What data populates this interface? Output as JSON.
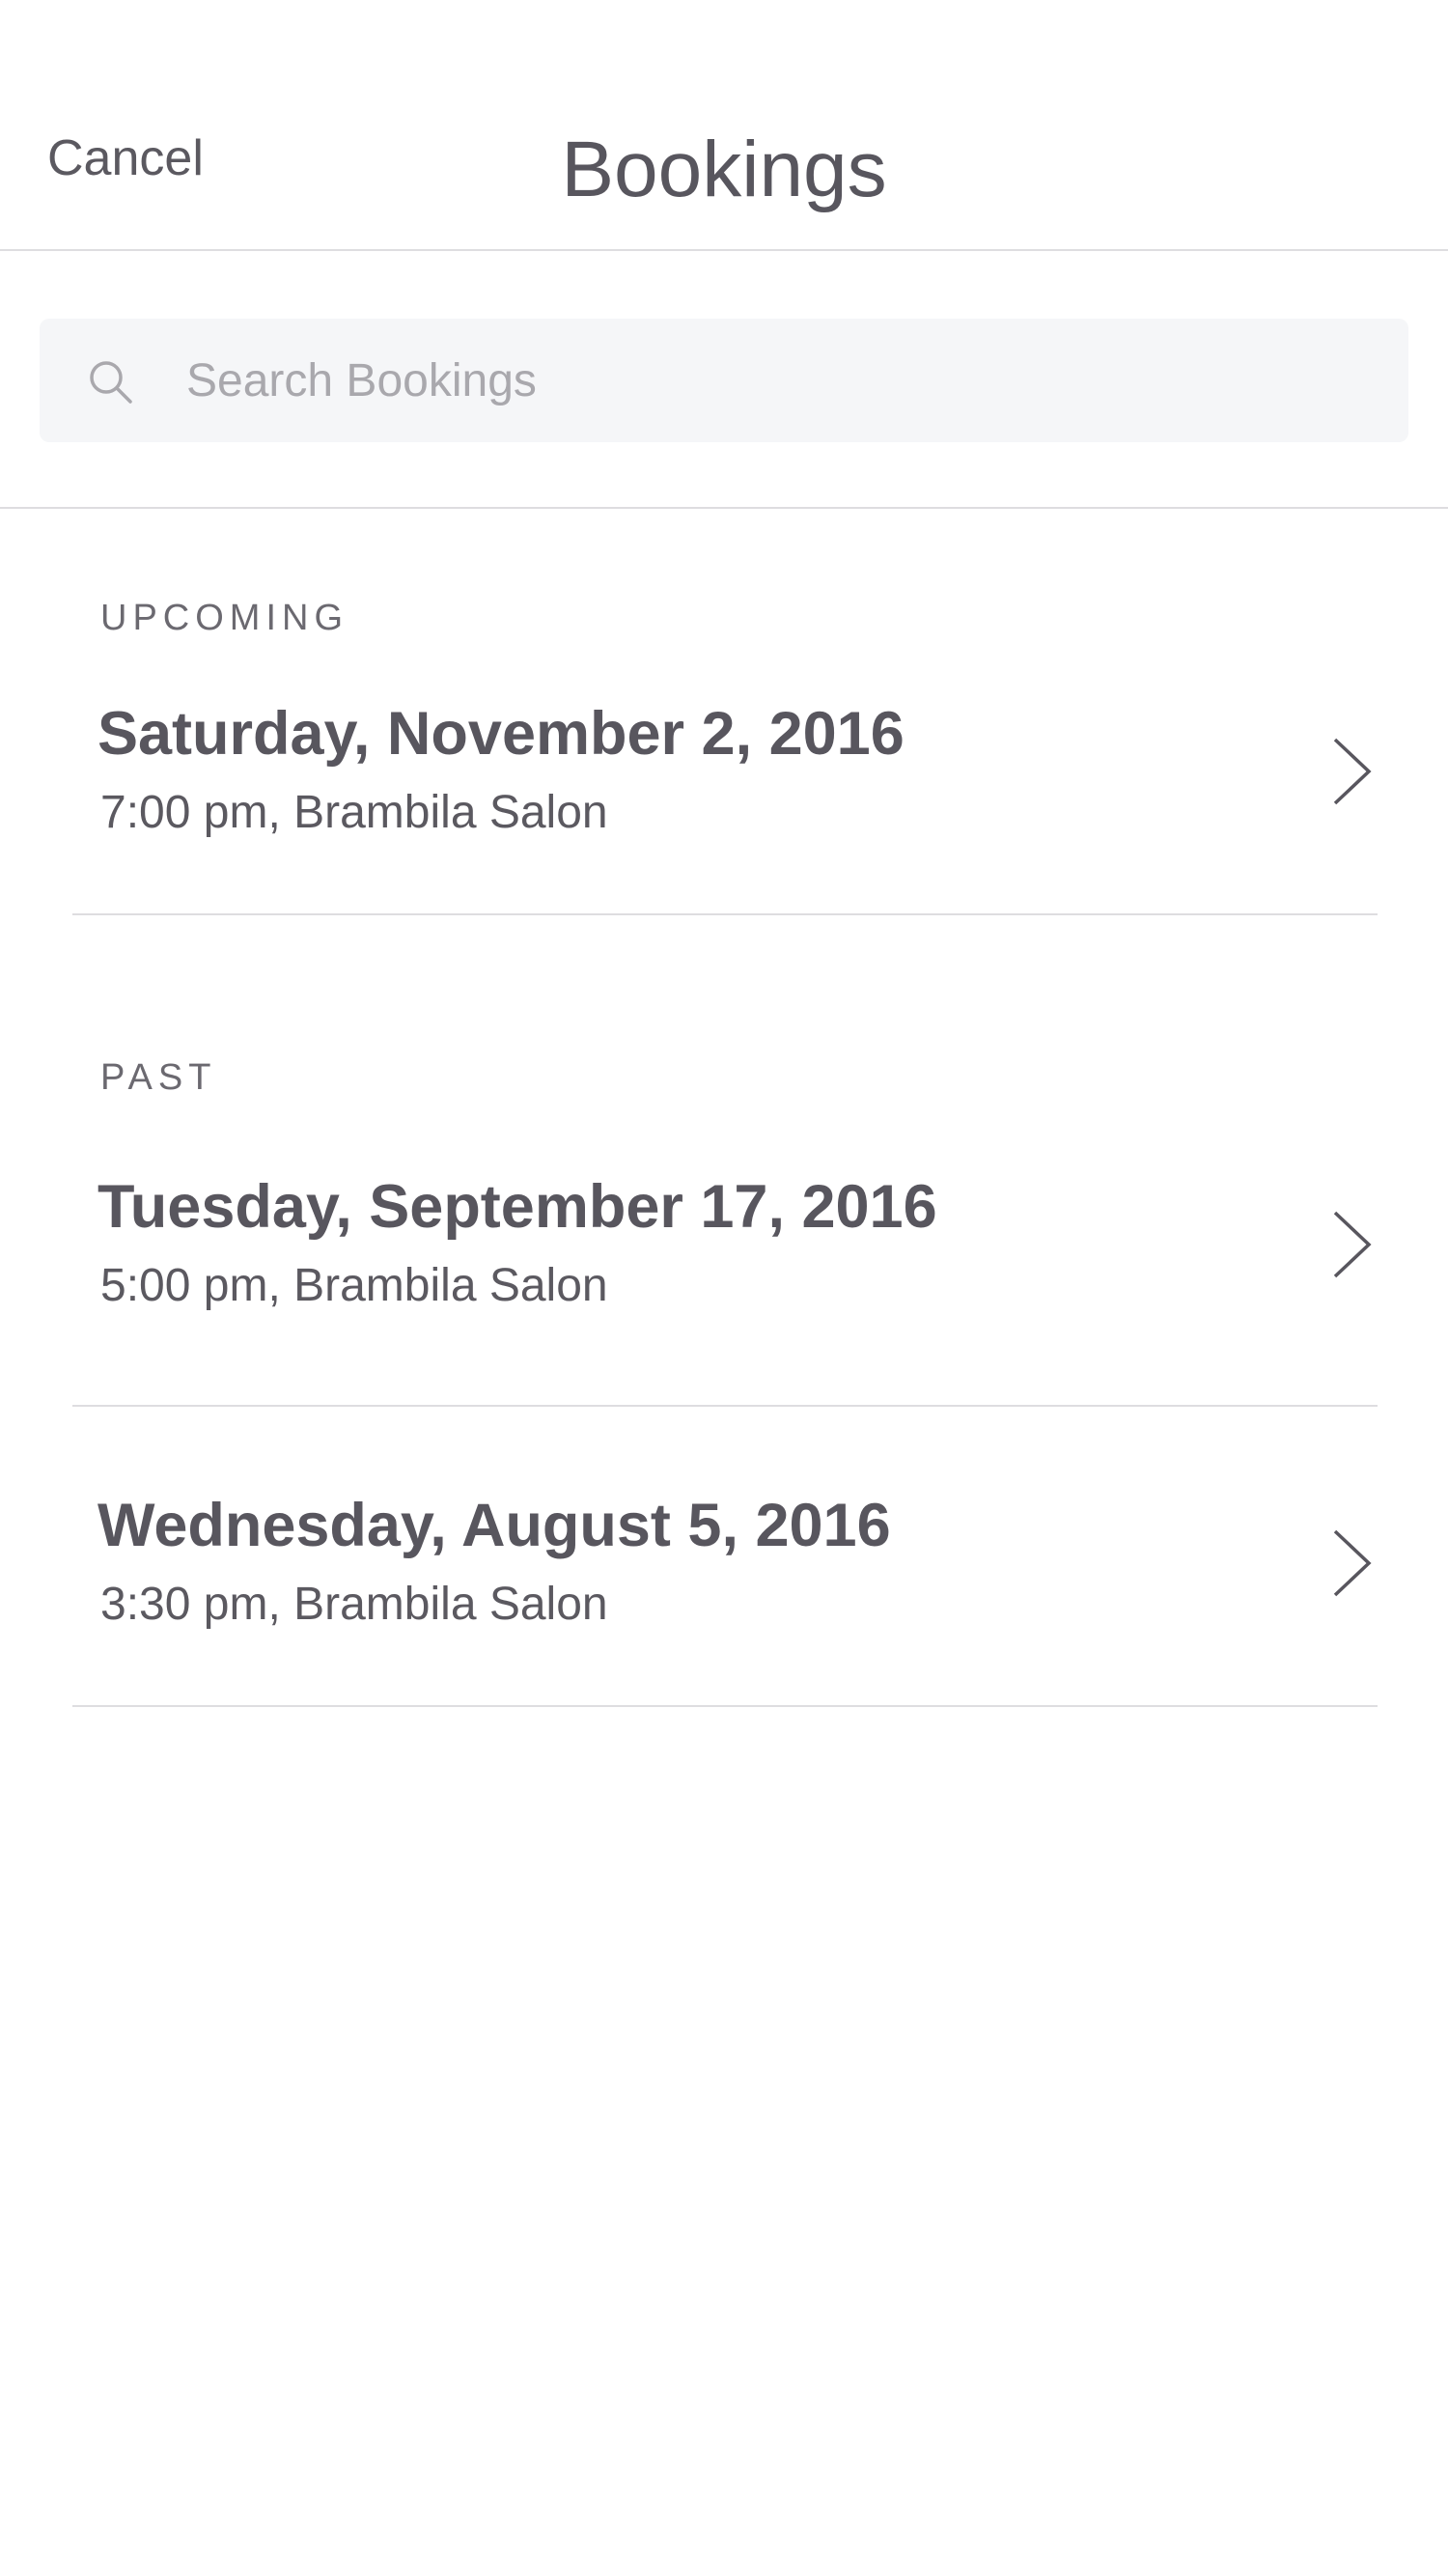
{
  "nav": {
    "cancel_label": "Cancel",
    "title": "Bookings"
  },
  "search": {
    "placeholder": "Search Bookings",
    "value": ""
  },
  "sections": {
    "upcoming": {
      "header": "UPCOMING",
      "bookings": [
        {
          "date": "Saturday, November 2, 2016",
          "detail": "7:00 pm, Brambila Salon"
        }
      ]
    },
    "past": {
      "header": "PAST",
      "bookings": [
        {
          "date": "Tuesday, September 17, 2016",
          "detail": "5:00 pm, Brambila Salon"
        },
        {
          "date": "Wednesday, August 5, 2016",
          "detail": "3:30 pm, Brambila Salon"
        }
      ]
    }
  },
  "icons": {
    "search": "search-icon",
    "row_chevron": "chevron-right-icon"
  },
  "colors": {
    "text": "#58565e",
    "muted_text": "#a9a8ad",
    "search_background": "#f5f6f8",
    "divider": "#dedde0"
  }
}
